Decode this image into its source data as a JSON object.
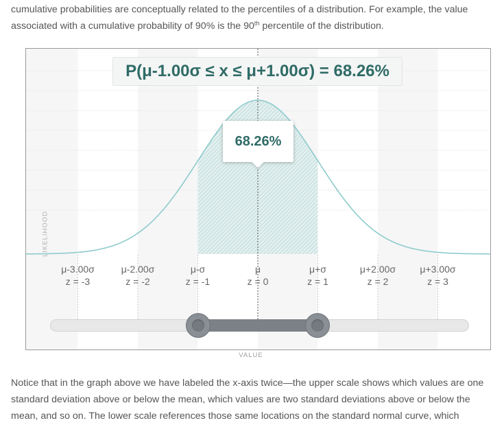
{
  "intro": {
    "text_before_sup": "cumulative probabilities are conceptually related to the percentiles of a distribution. For example, the value associated with a cumulative probability of 90% is the 90",
    "sup": "th",
    "text_after_sup": " percentile of the distribution."
  },
  "chart": {
    "title": "P(μ-1.00σ ≤ x ≤ μ+1.00σ) = 68.26%",
    "tooltip": "68.26%",
    "ylabel": "LIKELIHOOD",
    "xlabel": "VALUE",
    "ticks": [
      {
        "value": "μ-3.00σ",
        "z": "z = -3"
      },
      {
        "value": "μ-2.00σ",
        "z": "z = -2"
      },
      {
        "value": "μ-σ",
        "z": "z = -1"
      },
      {
        "value": "μ",
        "z": "z = 0"
      },
      {
        "value": "μ+σ",
        "z": "z = 1"
      },
      {
        "value": "μ+2.00σ",
        "z": "z = 2"
      },
      {
        "value": "μ+3.00σ",
        "z": "z = 3"
      }
    ],
    "curve_color": "#8ecbcc",
    "shade_color": "#cbe4e3"
  },
  "chart_data": {
    "type": "area",
    "title": "P(μ-1.00σ ≤ x ≤ μ+1.00σ) = 68.26%",
    "xlabel": "VALUE",
    "ylabel": "LIKELIHOOD",
    "distribution": "standard normal",
    "x_range": [
      -4,
      4
    ],
    "tick_z": [
      -3,
      -2,
      -1,
      0,
      1,
      2,
      3
    ],
    "shaded_interval_z": [
      -1,
      1
    ],
    "shaded_probability_percent": 68.26
  },
  "slider": {
    "range_z": [
      -1,
      1
    ],
    "min_z": -3.5,
    "max_z": 3.5
  },
  "outro": {
    "text": "Notice that in the graph above we have labeled the x-axis twice—the upper scale shows which values are one standard deviation above or below the mean, which values are two standard deviations above or below the mean, and so on. The lower scale references those same locations on the standard normal curve, which"
  }
}
